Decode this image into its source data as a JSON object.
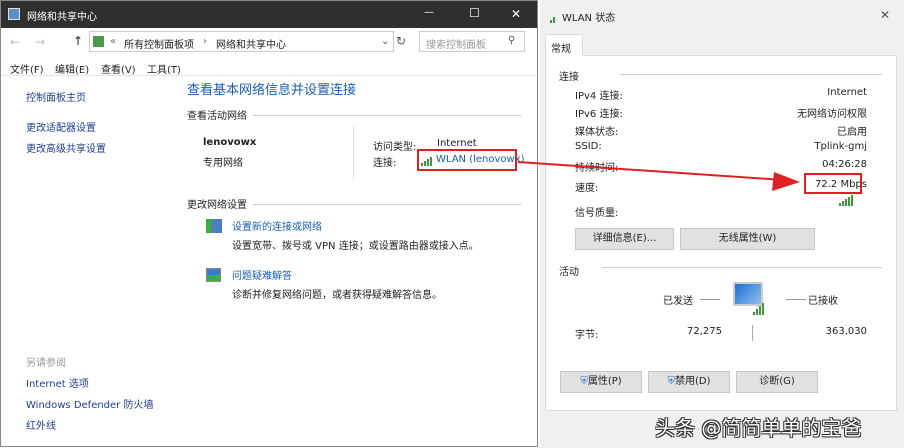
{
  "left_window": {
    "title": "网络和共享中心",
    "controls": {
      "minimize": "—",
      "maximize": "☐",
      "close": "✕"
    },
    "breadcrumb": {
      "prefix": "«",
      "items": [
        "所有控制面板项",
        "网络和共享中心"
      ],
      "sep": "›"
    },
    "search_placeholder": "搜索控制面板",
    "menu": [
      "文件(F)",
      "编辑(E)",
      "查看(V)",
      "工具(T)"
    ],
    "sidebar": {
      "links": [
        "控制面板主页",
        "更改适配器设置",
        "更改高级共享设置"
      ],
      "see_also_label": "另请参阅",
      "see_also": [
        "Internet 选项",
        "Windows Defender 防火墙",
        "红外线"
      ]
    },
    "main": {
      "heading": "查看基本网络信息并设置连接",
      "active_label": "查看活动网络",
      "network_name": "lenovowx",
      "network_type": "专用网络",
      "access_label": "访问类型:",
      "access_value": "Internet",
      "conn_label": "连接:",
      "conn_value": "WLAN (lenovowx)",
      "change_label": "更改网络设置",
      "tasks": [
        {
          "title": "设置新的连接或网络",
          "desc": "设置宽带、拨号或 VPN 连接；或设置路由器或接入点。"
        },
        {
          "title": "问题疑难解答",
          "desc": "诊断并修复网络问题，或者获得疑难解答信息。"
        }
      ]
    }
  },
  "dialog": {
    "title": "WLAN 状态",
    "close": "✕",
    "tab": "常规",
    "connection_label": "连接",
    "rows": [
      {
        "label": "IPv4 连接:",
        "value": "Internet"
      },
      {
        "label": "IPv6 连接:",
        "value": "无网络访问权限"
      },
      {
        "label": "媒体状态:",
        "value": "已启用"
      },
      {
        "label": "SSID:",
        "value": "Tplink-gmj"
      },
      {
        "label": "持续时间:",
        "value": "04:26:28"
      },
      {
        "label": "速度:",
        "value": "72.2 Mbps"
      }
    ],
    "signal_label": "信号质量:",
    "signal_level": 5,
    "btn_details": "详细信息(E)...",
    "btn_wireless": "无线属性(W)",
    "activity_label": "活动",
    "sent_label": "已发送",
    "recv_label": "已接收",
    "bytes_label": "字节:",
    "bytes_sent": "72,275",
    "bytes_recv": "363,030",
    "btn_props": "属性(P)",
    "btn_disable": "禁用(D)",
    "btn_diagnose": "诊断(G)"
  },
  "watermark": "头条 @简简单单的宝爸",
  "colors": {
    "highlight": "#e02020",
    "link": "#1a5fb4",
    "signal": "#3a9a3a"
  }
}
